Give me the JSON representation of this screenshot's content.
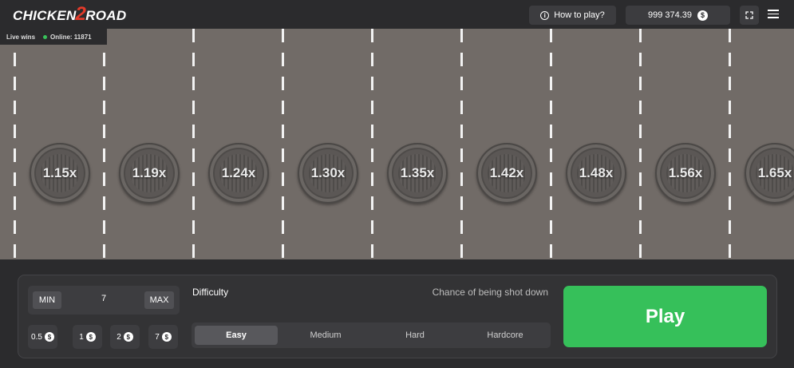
{
  "header": {
    "logo_left": "CHICKEN",
    "logo_mid": "2",
    "logo_right": "ROAD",
    "how_to_play": "How to play?",
    "balance": "999 374.39",
    "coin_symbol": "$"
  },
  "live": {
    "label": "Live wins",
    "online": "Online: 11871"
  },
  "multipliers": [
    "1.15x",
    "1.19x",
    "1.24x",
    "1.30x",
    "1.35x",
    "1.42x",
    "1.48x",
    "1.56x",
    "1.65x"
  ],
  "bet": {
    "min_label": "MIN",
    "max_label": "MAX",
    "value": "7",
    "quick": [
      "0.5",
      "1",
      "2",
      "7"
    ]
  },
  "difficulty": {
    "label": "Difficulty",
    "chance_label": "Chance of being shot down",
    "options": [
      "Easy",
      "Medium",
      "Hard",
      "Hardcore"
    ],
    "selected": "Easy"
  },
  "play_label": "Play",
  "colors": {
    "accent_green": "#36c05a",
    "road": "#716b67",
    "logo_red": "#e33a2a"
  }
}
